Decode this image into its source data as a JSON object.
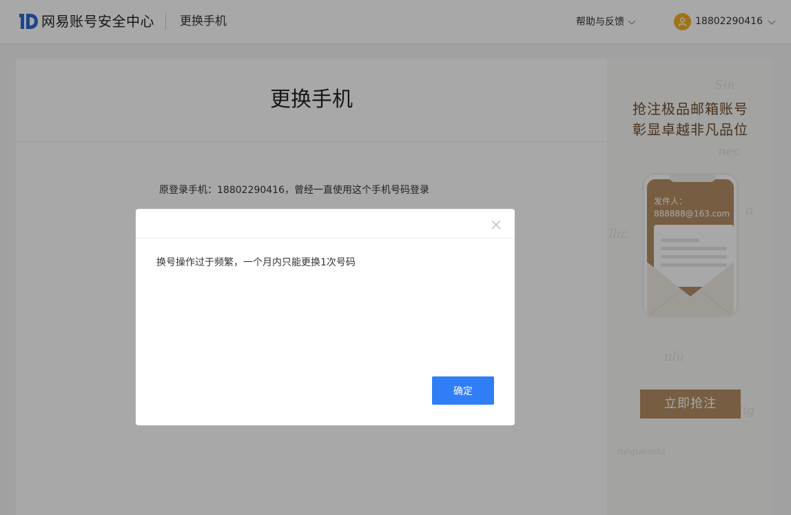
{
  "header": {
    "logo_text": "网易账号安全中心",
    "subtitle": "更换手机",
    "help_label": "帮助与反馈",
    "user_phone": "18802290416"
  },
  "main": {
    "title": "更换手机",
    "original_phone_text": "原登录手机：18802290416，曾经一直使用这个手机号码登录"
  },
  "ad": {
    "line1": "抢注极品邮箱账号",
    "line2": "彰显卓越非凡品位",
    "sender_label": "发件人：",
    "sender_email": "888888@163.com",
    "button_label": "立即抢注"
  },
  "modal": {
    "message": "换号操作过于频繁，一个月内只能更换1次号码",
    "ok_label": "确定"
  },
  "colors": {
    "primary_blue": "#2f7ef7",
    "ad_gold": "#b58e63",
    "avatar_orange": "#f2b027",
    "logo_blue": "#2a6ad8"
  },
  "icons": [
    "netease-id-logo-icon",
    "chevron-down-icon",
    "user-avatar-icon",
    "close-icon"
  ]
}
